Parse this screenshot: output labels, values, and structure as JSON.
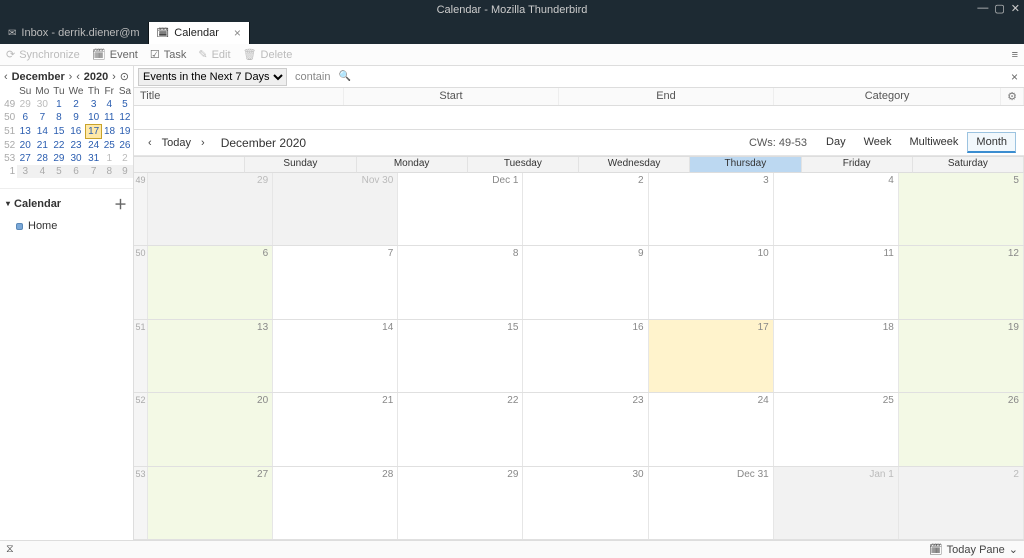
{
  "window": {
    "title": "Calendar - Mozilla Thunderbird"
  },
  "tabs": [
    {
      "label": "Inbox - derrik.diener@m",
      "active": false
    },
    {
      "label": "Calendar",
      "active": true
    }
  ],
  "toolbar": {
    "synchronize": "Synchronize",
    "event": "Event",
    "task": "Task",
    "edit": "Edit",
    "delete": "Delete"
  },
  "minical": {
    "month": "December",
    "year": "2020",
    "dow": [
      "Su",
      "Mo",
      "Tu",
      "We",
      "Th",
      "Fr",
      "Sa"
    ],
    "weeks": [
      {
        "wk": "49",
        "days": [
          "29",
          "30",
          "1",
          "2",
          "3",
          "4",
          "5"
        ],
        "dim": [
          0,
          1
        ]
      },
      {
        "wk": "50",
        "days": [
          "6",
          "7",
          "8",
          "9",
          "10",
          "11",
          "12"
        ],
        "dim": []
      },
      {
        "wk": "51",
        "days": [
          "13",
          "14",
          "15",
          "16",
          "17",
          "18",
          "19"
        ],
        "dim": [],
        "today": 4
      },
      {
        "wk": "52",
        "days": [
          "20",
          "21",
          "22",
          "23",
          "24",
          "25",
          "26"
        ],
        "dim": []
      },
      {
        "wk": "53",
        "days": [
          "27",
          "28",
          "29",
          "30",
          "31",
          "1",
          "2"
        ],
        "dim": [
          5,
          6
        ]
      },
      {
        "wk": "1",
        "days": [
          "3",
          "4",
          "5",
          "6",
          "7",
          "8",
          "9"
        ],
        "dim": [
          0,
          1,
          2,
          3,
          4,
          5,
          6
        ],
        "gray": true
      }
    ]
  },
  "calendarSection": {
    "title": "Calendar",
    "items": [
      "Home"
    ]
  },
  "filter": {
    "selected": "Events in the Next 7 Days",
    "contain": "contain"
  },
  "listHeaders": {
    "title": "Title",
    "start": "Start",
    "end": "End",
    "category": "Category"
  },
  "nav": {
    "today": "Today",
    "label": "December 2020",
    "cw": "CWs: 49-53"
  },
  "viewTabs": {
    "day": "Day",
    "week": "Week",
    "multiweek": "Multiweek",
    "month": "Month"
  },
  "grid": {
    "dayNames": [
      "Sunday",
      "Monday",
      "Tuesday",
      "Wednesday",
      "Thursday",
      "Friday",
      "Saturday"
    ],
    "todayCol": 4,
    "weeks": [
      {
        "wk": "49",
        "cells": [
          {
            "n": "29",
            "cls": "outside"
          },
          {
            "n": "Nov 30",
            "cls": "outside"
          },
          {
            "n": "Dec 1",
            "cls": ""
          },
          {
            "n": "2",
            "cls": ""
          },
          {
            "n": "3",
            "cls": ""
          },
          {
            "n": "4",
            "cls": ""
          },
          {
            "n": "5",
            "cls": "nonwork"
          }
        ]
      },
      {
        "wk": "50",
        "cells": [
          {
            "n": "6",
            "cls": "nonwork"
          },
          {
            "n": "7",
            "cls": ""
          },
          {
            "n": "8",
            "cls": ""
          },
          {
            "n": "9",
            "cls": ""
          },
          {
            "n": "10",
            "cls": ""
          },
          {
            "n": "11",
            "cls": ""
          },
          {
            "n": "12",
            "cls": "nonwork"
          }
        ]
      },
      {
        "wk": "51",
        "cells": [
          {
            "n": "13",
            "cls": "nonwork"
          },
          {
            "n": "14",
            "cls": ""
          },
          {
            "n": "15",
            "cls": ""
          },
          {
            "n": "16",
            "cls": ""
          },
          {
            "n": "17",
            "cls": "today"
          },
          {
            "n": "18",
            "cls": ""
          },
          {
            "n": "19",
            "cls": "nonwork"
          }
        ]
      },
      {
        "wk": "52",
        "cells": [
          {
            "n": "20",
            "cls": "nonwork"
          },
          {
            "n": "21",
            "cls": ""
          },
          {
            "n": "22",
            "cls": ""
          },
          {
            "n": "23",
            "cls": ""
          },
          {
            "n": "24",
            "cls": ""
          },
          {
            "n": "25",
            "cls": ""
          },
          {
            "n": "26",
            "cls": "nonwork"
          }
        ]
      },
      {
        "wk": "53",
        "cells": [
          {
            "n": "27",
            "cls": "nonwork"
          },
          {
            "n": "28",
            "cls": ""
          },
          {
            "n": "29",
            "cls": ""
          },
          {
            "n": "30",
            "cls": ""
          },
          {
            "n": "Dec 31",
            "cls": ""
          },
          {
            "n": "Jan 1",
            "cls": "outside"
          },
          {
            "n": "2",
            "cls": "outside"
          }
        ]
      }
    ]
  },
  "statusbar": {
    "todaypane": "Today Pane"
  }
}
